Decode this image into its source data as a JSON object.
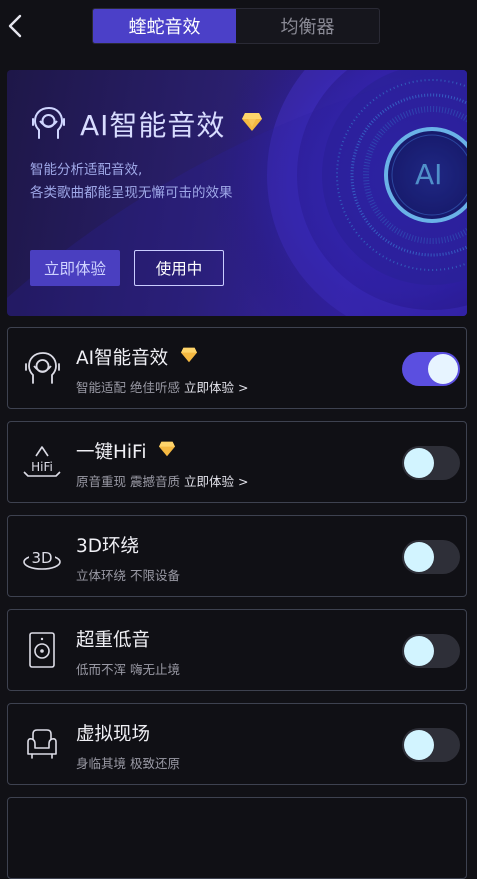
{
  "header": {
    "tabs": [
      {
        "label": "蝰蛇音效",
        "active": true
      },
      {
        "label": "均衡器",
        "active": false
      }
    ]
  },
  "banner": {
    "title": "AI智能音效",
    "desc_line1": "智能分析适配音效,",
    "desc_line2": "各类歌曲都能呈现无懈可击的效果",
    "try_label": "立即体验",
    "using_label": "使用中",
    "orb_label": "AI"
  },
  "effects": [
    {
      "title": "AI智能音效",
      "subtitle": "智能适配 绝佳听感",
      "link": "立即体验 >",
      "vip": true,
      "enabled": true,
      "icon": "ai-head-icon"
    },
    {
      "title": "一键HiFi",
      "subtitle": "原音重现 震撼音质",
      "link": "立即体验 >",
      "vip": true,
      "enabled": false,
      "icon": "hifi-icon",
      "icon_text": "HiFi"
    },
    {
      "title": "3D环绕",
      "subtitle": "立体环绕 不限设备",
      "vip": false,
      "enabled": false,
      "icon": "3d-surround-icon",
      "icon_text": "3D"
    },
    {
      "title": "超重低音",
      "subtitle": "低而不浑 嗨无止境",
      "vip": false,
      "enabled": false,
      "icon": "speaker-icon"
    },
    {
      "title": "虚拟现场",
      "subtitle": "身临其境 极致还原",
      "vip": false,
      "enabled": false,
      "icon": "armchair-icon"
    }
  ],
  "colors": {
    "accent": "#4b40c8",
    "toggle_on": "#5b4fe0",
    "vip_gold": "#f5b942"
  }
}
